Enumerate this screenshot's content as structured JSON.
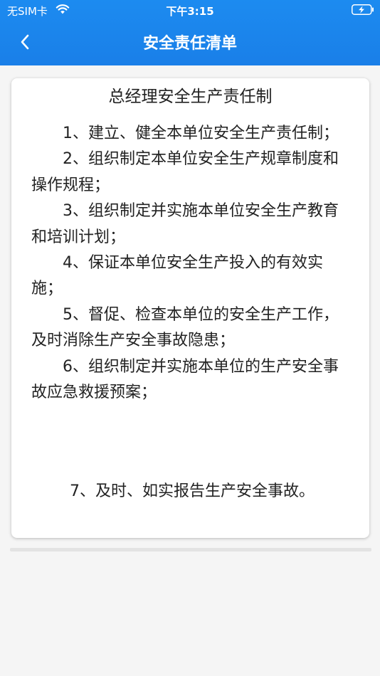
{
  "status_bar": {
    "carrier": "无SIM卡",
    "time": "下午3:15"
  },
  "header": {
    "title": "安全责任清单",
    "back_icon": "chevron-left-icon"
  },
  "document": {
    "title": "总经理安全生产责任制",
    "clauses": [
      "1、建立、健全本单位安全生产责任制；",
      "2、组织制定本单位安全生产规章制度和操作规程；",
      "3、组织制定并实施本单位安全生产教育和培训计划；",
      "4、保证本单位安全生产投入的有效实施；",
      "5、督促、检查本单位的安全生产工作，及时消除生产安全事故隐患；",
      "6、组织制定并实施本单位的生产安全事故应急救援预案；"
    ],
    "last_clause": "7、及时、如实报告生产安全事故。"
  },
  "colors": {
    "header_blue": "#1a7fe8",
    "background": "#f5f5f5"
  }
}
